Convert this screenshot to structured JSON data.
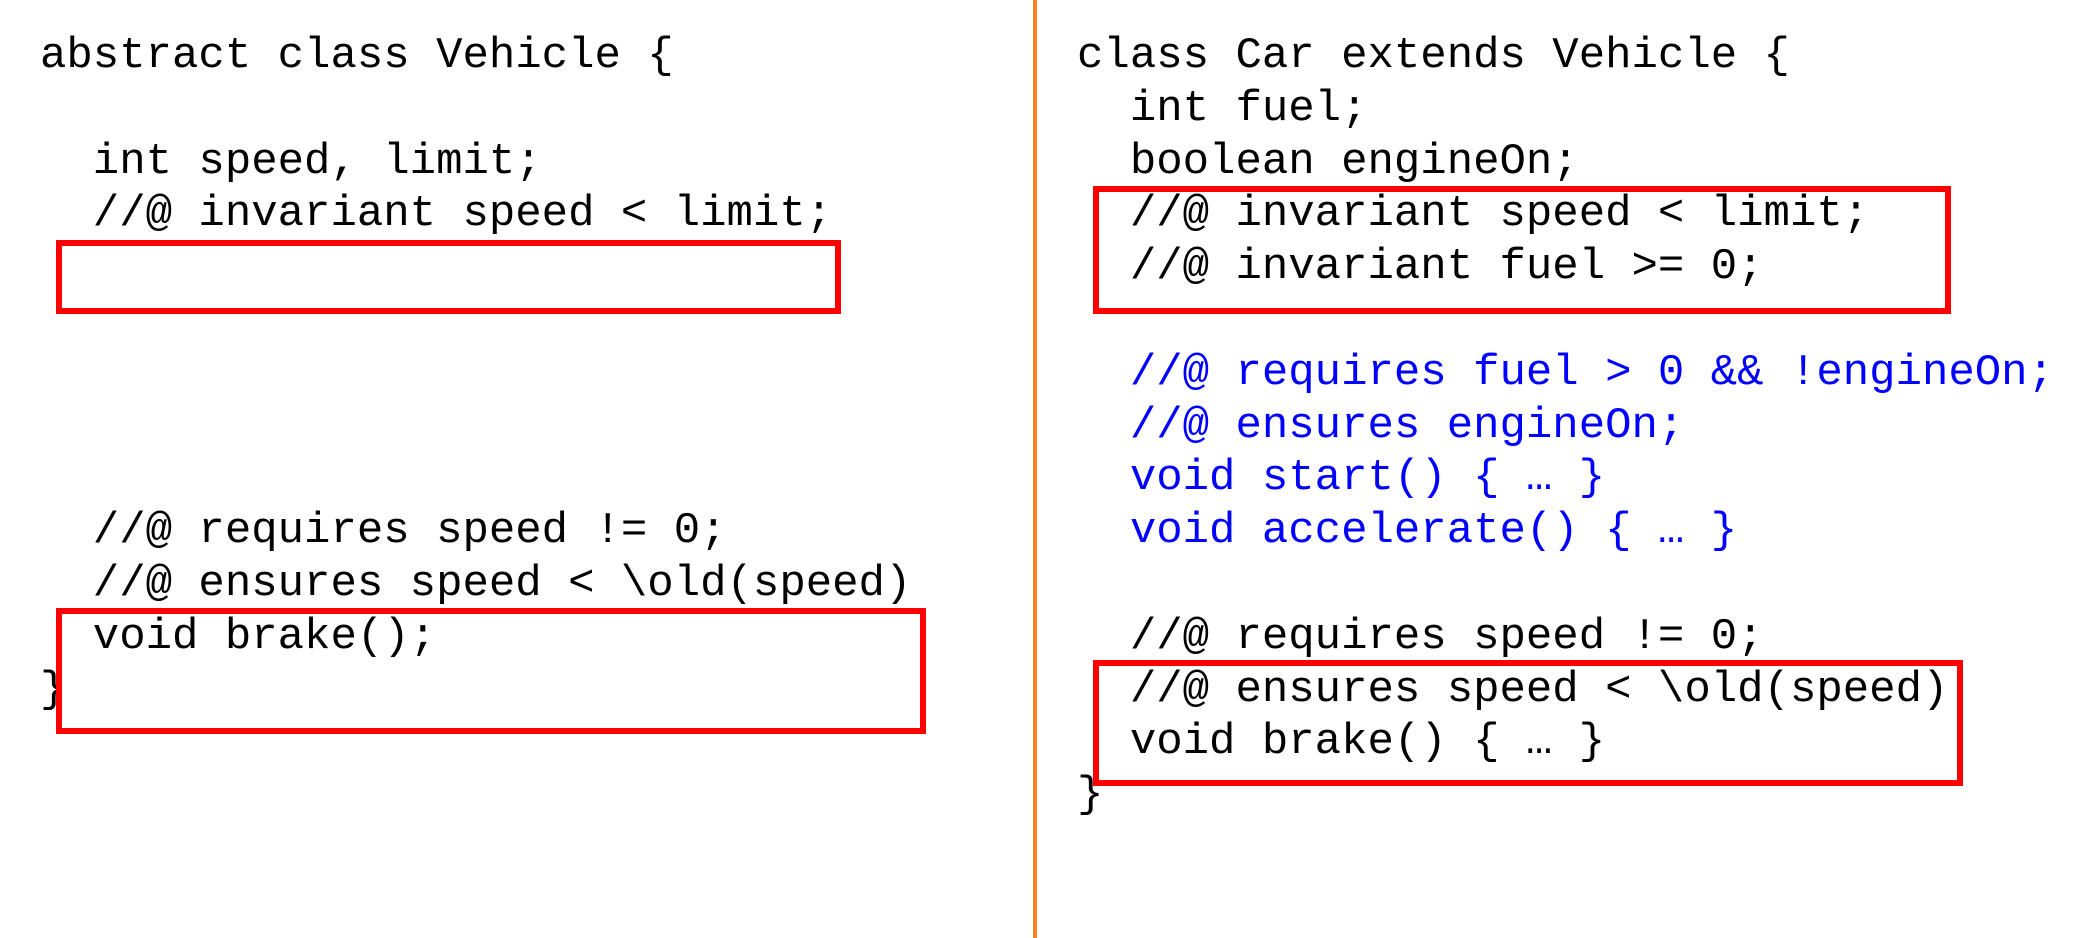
{
  "left": {
    "l1": "abstract class Vehicle {",
    "l2": "",
    "l3": "  int speed, limit;",
    "l4": "  //@ invariant speed < limit;",
    "l5": "",
    "l6": "",
    "l7": "",
    "l8": "",
    "l9": "",
    "l10": "  //@ requires speed != 0;",
    "l11": "  //@ ensures speed < \\old(speed)",
    "l12": "  void brake();",
    "l13": "}"
  },
  "right": {
    "l1": "class Car extends Vehicle {",
    "l2": "  int fuel;",
    "l3": "  boolean engineOn;",
    "l4": "  //@ invariant speed < limit;",
    "l5": "  //@ invariant fuel >= 0;",
    "l6": "",
    "l7": "  //@ requires fuel > 0 && !engineOn;",
    "l8": "  //@ ensures engineOn;",
    "l9": "  void start() { … }",
    "l10": "  void accelerate() { … }",
    "l11": "",
    "l12": "  //@ requires speed != 0;",
    "l13": "  //@ ensures speed < \\old(speed)",
    "l14": "  void brake() { … }",
    "l15": "}"
  }
}
